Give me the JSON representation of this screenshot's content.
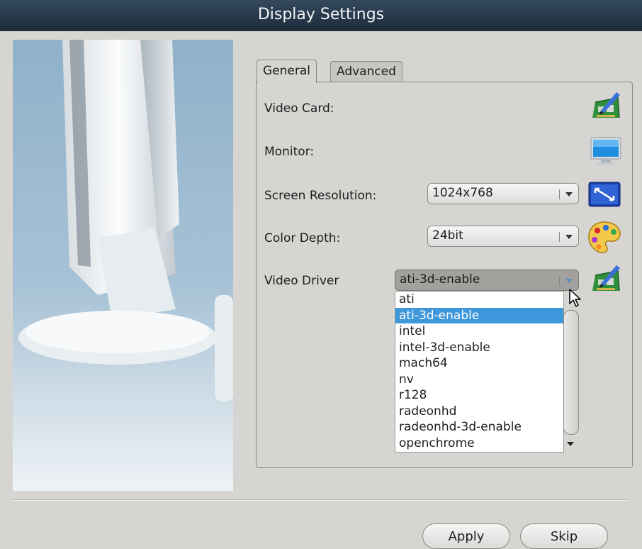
{
  "window": {
    "title": "Display Settings"
  },
  "tabs": [
    {
      "label": "General",
      "active": true
    },
    {
      "label": "Advanced",
      "active": false
    }
  ],
  "fields": {
    "video_card": {
      "label": "Video Card:"
    },
    "monitor": {
      "label": "Monitor:"
    },
    "screen_resolution": {
      "label": "Screen Resolution:",
      "value": "1024x768"
    },
    "color_depth": {
      "label": "Color Depth:",
      "value": "24bit"
    },
    "video_driver": {
      "label": "Video Driver",
      "value": "ati-3d-enable"
    }
  },
  "driver_options": [
    "ati",
    "ati-3d-enable",
    "intel",
    "intel-3d-enable",
    "mach64",
    "nv",
    "r128",
    "radeonhd",
    "radeonhd-3d-enable",
    "openchrome"
  ],
  "selected_driver_index": 1,
  "buttons": {
    "apply": "Apply",
    "skip": "Skip"
  },
  "icons": {
    "video_card": "video-card-icon",
    "monitor": "monitor-icon",
    "resolution": "resolution-icon",
    "color_depth": "palette-icon",
    "video_driver": "driver-icon"
  },
  "colors": {
    "titlebar": "#1d2b3a",
    "selection": "#3e97db",
    "window_bg": "#d7d5d2"
  }
}
